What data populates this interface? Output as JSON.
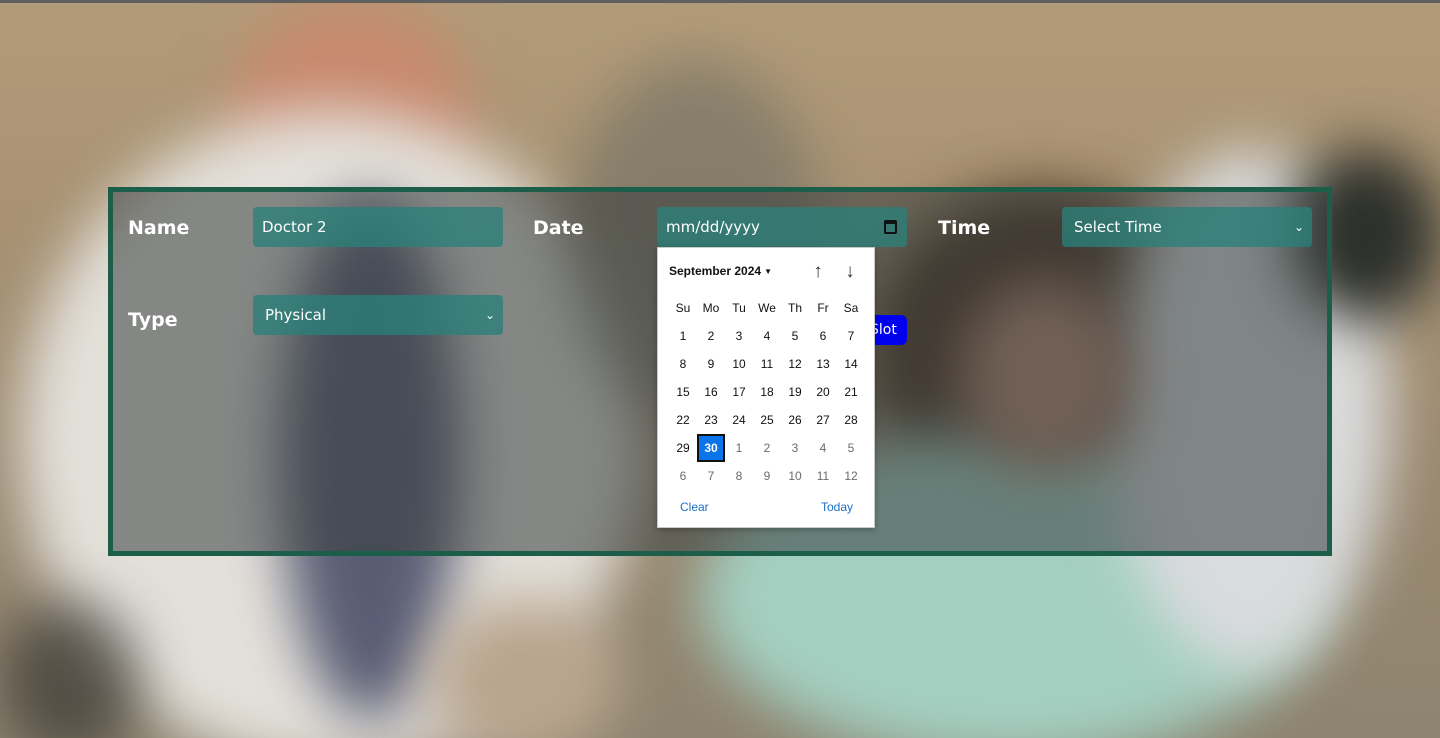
{
  "form": {
    "name_label": "Name",
    "name_value": "Doctor 2",
    "date_label": "Date",
    "date_placeholder": "mm/dd/yyyy",
    "time_label": "Time",
    "time_value": "Select Time",
    "type_label": "Type",
    "type_value": "Physical",
    "submit_label": "Slot"
  },
  "datepicker": {
    "month_label": "September 2024",
    "weekdays": [
      "Su",
      "Mo",
      "Tu",
      "We",
      "Th",
      "Fr",
      "Sa"
    ],
    "weeks": [
      [
        "1",
        "2",
        "3",
        "4",
        "5",
        "6",
        "7"
      ],
      [
        "8",
        "9",
        "10",
        "11",
        "12",
        "13",
        "14"
      ],
      [
        "15",
        "16",
        "17",
        "18",
        "19",
        "20",
        "21"
      ],
      [
        "22",
        "23",
        "24",
        "25",
        "26",
        "27",
        "28"
      ],
      [
        "29",
        "30",
        "1",
        "2",
        "3",
        "4",
        "5"
      ],
      [
        "6",
        "7",
        "8",
        "9",
        "10",
        "11",
        "12"
      ]
    ],
    "other_month_from": {
      "week": 4,
      "day": 2
    },
    "selected": {
      "week": 4,
      "day": 1
    },
    "clear_label": "Clear",
    "today_label": "Today"
  },
  "colors": {
    "panel_border": "#1d5e4a",
    "field_bg": "#2a807a",
    "selected_day": "#0a74e8",
    "submit_button": "#0000ee",
    "footer_link": "#1a6fc7"
  },
  "icons": {
    "calendar": "calendar-icon",
    "chevron": "chevron-down-icon",
    "nav_up": "arrow-up-icon",
    "nav_down": "arrow-down-icon"
  }
}
